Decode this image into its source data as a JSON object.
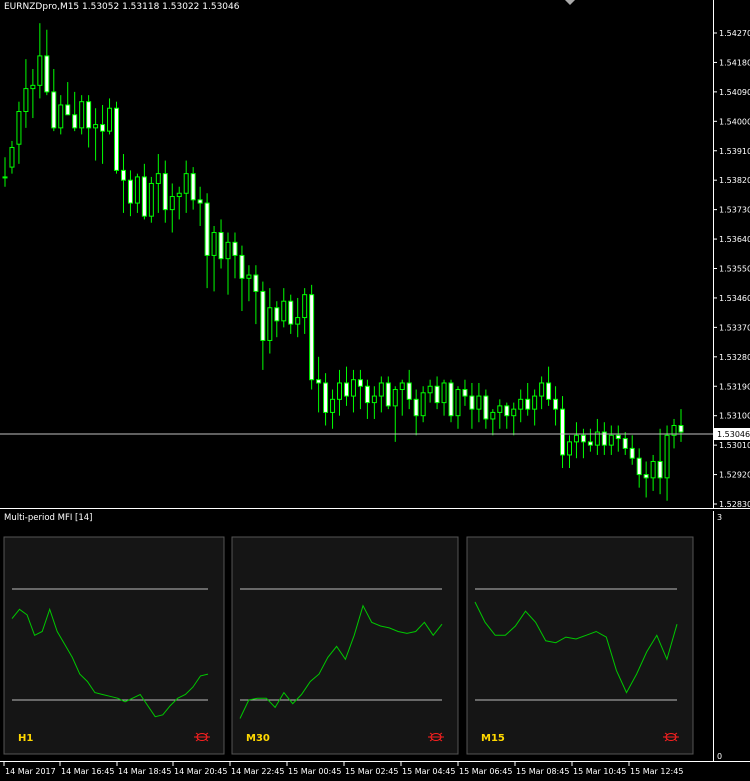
{
  "window": {
    "symbol_line": "EURNZDpro,M15  1.53052 1.53118 1.53022 1.53046",
    "current_price_label": "1.53046",
    "indicator_title": "Multi-period MFI [14]"
  },
  "colors": {
    "background": "#000000",
    "candle_up": "#000000",
    "candle_down": "#ffffff",
    "candle_outline": "#00ff00",
    "bid_line": "#c0c0c0",
    "mfi_line": "#00c800",
    "panel_bg": "#151515",
    "label": "#ffd800",
    "alert_icon": "#ff2020"
  },
  "price_axis": {
    "labels": [
      "1.54270",
      "1.54180",
      "1.54090",
      "1.54000",
      "1.53910",
      "1.53820",
      "1.53730",
      "1.53640",
      "1.53550",
      "1.53460",
      "1.53370",
      "1.53280",
      "1.53190",
      "1.53100",
      "1.53010",
      "1.52920",
      "1.52830"
    ],
    "values": [
      1.5427,
      1.5418,
      1.5409,
      1.54,
      1.5391,
      1.5382,
      1.5373,
      1.5364,
      1.5355,
      1.5346,
      1.5337,
      1.5328,
      1.5319,
      1.531,
      1.5301,
      1.5292,
      1.5283
    ]
  },
  "indicator_axis": {
    "max_label": "3",
    "min_label": "0"
  },
  "time_axis": {
    "labels": [
      "14 Mar 2017",
      "14 Mar 16:45",
      "14 Mar 18:45",
      "14 Mar 20:45",
      "14 Mar 22:45",
      "15 Mar 00:45",
      "15 Mar 02:45",
      "15 Mar 04:45",
      "15 Mar 06:45",
      "15 Mar 08:45",
      "15 Mar 10:45",
      "15 Mar 12:45"
    ]
  },
  "mfi_panels": [
    {
      "label": "H1",
      "icon": "alarm-icon",
      "overbought": 80,
      "oversold": 20,
      "values": [
        64,
        69,
        66,
        55,
        57,
        69,
        57,
        50,
        43,
        34,
        30,
        24,
        23,
        22,
        21,
        19,
        21,
        23,
        17,
        11,
        12,
        17,
        21,
        23,
        27,
        33,
        34
      ]
    },
    {
      "label": "M30",
      "icon": "alarm-icon",
      "overbought": 80,
      "oversold": 20,
      "values": [
        10,
        20,
        21,
        21,
        16,
        24,
        18,
        23,
        30,
        34,
        43,
        49,
        42,
        55,
        71,
        62,
        60,
        59,
        57,
        56,
        57,
        62,
        55,
        61
      ]
    },
    {
      "label": "M15",
      "icon": "alarm-icon",
      "overbought": 80,
      "oversold": 20,
      "values": [
        73,
        62,
        55,
        55,
        60,
        68,
        62,
        52,
        51,
        54,
        53,
        55,
        57,
        54,
        36,
        24,
        34,
        46,
        55,
        42,
        61
      ]
    }
  ],
  "chart_data": {
    "type": "candlestick",
    "symbol": "EURNZDpro,M15",
    "ylim": [
      1.5283,
      1.5432
    ],
    "candles": [
      [
        1.5383,
        1.5389,
        1.538,
        1.5383
      ],
      [
        1.5386,
        1.5394,
        1.5384,
        1.5392
      ],
      [
        1.5393,
        1.5406,
        1.5387,
        1.5403
      ],
      [
        1.5403,
        1.5419,
        1.5398,
        1.541
      ],
      [
        1.541,
        1.5416,
        1.5401,
        1.5411
      ],
      [
        1.5411,
        1.543,
        1.5407,
        1.542
      ],
      [
        1.542,
        1.5428,
        1.5408,
        1.5409
      ],
      [
        1.5409,
        1.5416,
        1.5397,
        1.5398
      ],
      [
        1.5398,
        1.5408,
        1.5396,
        1.5405
      ],
      [
        1.5405,
        1.5412,
        1.5402,
        1.5402
      ],
      [
        1.5402,
        1.5409,
        1.5397,
        1.5398
      ],
      [
        1.5398,
        1.5408,
        1.5396,
        1.5406
      ],
      [
        1.5406,
        1.5408,
        1.5392,
        1.5398
      ],
      [
        1.5398,
        1.5404,
        1.5388,
        1.5399
      ],
      [
        1.5399,
        1.5405,
        1.5387,
        1.5397
      ],
      [
        1.5397,
        1.5407,
        1.5396,
        1.5404
      ],
      [
        1.5404,
        1.5406,
        1.5384,
        1.5385
      ],
      [
        1.5385,
        1.539,
        1.5372,
        1.5382
      ],
      [
        1.5382,
        1.5385,
        1.5371,
        1.5375
      ],
      [
        1.5375,
        1.5384,
        1.5372,
        1.5383
      ],
      [
        1.5383,
        1.5387,
        1.537,
        1.5371
      ],
      [
        1.5371,
        1.5383,
        1.5369,
        1.5381
      ],
      [
        1.5381,
        1.539,
        1.5372,
        1.5384
      ],
      [
        1.5384,
        1.5388,
        1.5369,
        1.5373
      ],
      [
        1.5373,
        1.5381,
        1.5366,
        1.5377
      ],
      [
        1.5377,
        1.538,
        1.537,
        1.5378
      ],
      [
        1.5378,
        1.5388,
        1.5372,
        1.5384
      ],
      [
        1.5384,
        1.5386,
        1.5373,
        1.5376
      ],
      [
        1.5376,
        1.538,
        1.5368,
        1.5375
      ],
      [
        1.5375,
        1.5378,
        1.5349,
        1.5359
      ],
      [
        1.5359,
        1.5368,
        1.5348,
        1.5366
      ],
      [
        1.5366,
        1.537,
        1.5355,
        1.5358
      ],
      [
        1.5358,
        1.5366,
        1.5347,
        1.5363
      ],
      [
        1.5363,
        1.5366,
        1.5352,
        1.5359
      ],
      [
        1.5359,
        1.5362,
        1.5342,
        1.5352
      ],
      [
        1.5352,
        1.5356,
        1.5345,
        1.5353
      ],
      [
        1.5353,
        1.5356,
        1.5338,
        1.5348
      ],
      [
        1.5348,
        1.5351,
        1.5324,
        1.5333
      ],
      [
        1.5333,
        1.5349,
        1.5329,
        1.5343
      ],
      [
        1.5343,
        1.5345,
        1.5334,
        1.5339
      ],
      [
        1.5339,
        1.5349,
        1.5337,
        1.5345
      ],
      [
        1.5345,
        1.5347,
        1.5335,
        1.5338
      ],
      [
        1.5338,
        1.5346,
        1.5334,
        1.534
      ],
      [
        1.534,
        1.5349,
        1.5335,
        1.5347
      ],
      [
        1.5347,
        1.535,
        1.5318,
        1.5321
      ],
      [
        1.5321,
        1.5328,
        1.5311,
        1.532
      ],
      [
        1.532,
        1.5323,
        1.5307,
        1.5311
      ],
      [
        1.5311,
        1.5318,
        1.5306,
        1.5315
      ],
      [
        1.5315,
        1.5324,
        1.531,
        1.532
      ],
      [
        1.532,
        1.5325,
        1.5313,
        1.5316
      ],
      [
        1.5316,
        1.5324,
        1.5311,
        1.5321
      ],
      [
        1.5321,
        1.5324,
        1.5312,
        1.5319
      ],
      [
        1.5319,
        1.5321,
        1.5309,
        1.5314
      ],
      [
        1.5314,
        1.5319,
        1.5309,
        1.5316
      ],
      [
        1.5316,
        1.5322,
        1.5311,
        1.532
      ],
      [
        1.532,
        1.5322,
        1.5312,
        1.5313
      ],
      [
        1.5313,
        1.5319,
        1.5302,
        1.5318
      ],
      [
        1.5318,
        1.5321,
        1.531,
        1.532
      ],
      [
        1.532,
        1.5324,
        1.5312,
        1.5315
      ],
      [
        1.5315,
        1.5318,
        1.5304,
        1.531
      ],
      [
        1.531,
        1.5319,
        1.5308,
        1.5317
      ],
      [
        1.5317,
        1.5321,
        1.5314,
        1.5319
      ],
      [
        1.5319,
        1.5322,
        1.5312,
        1.5314
      ],
      [
        1.5314,
        1.5321,
        1.531,
        1.532
      ],
      [
        1.532,
        1.5321,
        1.5308,
        1.531
      ],
      [
        1.531,
        1.5319,
        1.5306,
        1.5318
      ],
      [
        1.5318,
        1.5321,
        1.5313,
        1.5316
      ],
      [
        1.5316,
        1.532,
        1.5306,
        1.5312
      ],
      [
        1.5312,
        1.532,
        1.5308,
        1.5316
      ],
      [
        1.5316,
        1.5318,
        1.5306,
        1.5309
      ],
      [
        1.5309,
        1.5312,
        1.5304,
        1.5311
      ],
      [
        1.5311,
        1.5315,
        1.5306,
        1.5313
      ],
      [
        1.5313,
        1.5314,
        1.5306,
        1.531
      ],
      [
        1.531,
        1.5314,
        1.5304,
        1.5312
      ],
      [
        1.5312,
        1.5318,
        1.5308,
        1.5315
      ],
      [
        1.5315,
        1.532,
        1.531,
        1.5312
      ],
      [
        1.5312,
        1.5318,
        1.5307,
        1.5316
      ],
      [
        1.5316,
        1.5322,
        1.5312,
        1.532
      ],
      [
        1.532,
        1.5325,
        1.5313,
        1.5315
      ],
      [
        1.5315,
        1.5319,
        1.5307,
        1.5312
      ],
      [
        1.5312,
        1.5316,
        1.5294,
        1.5298
      ],
      [
        1.5298,
        1.5304,
        1.5294,
        1.5302
      ],
      [
        1.5302,
        1.5308,
        1.5297,
        1.5304
      ],
      [
        1.5304,
        1.5306,
        1.5297,
        1.5302
      ],
      [
        1.5302,
        1.5306,
        1.5299,
        1.5301
      ],
      [
        1.5301,
        1.5309,
        1.5298,
        1.5305
      ],
      [
        1.5305,
        1.5308,
        1.5298,
        1.5301
      ],
      [
        1.5301,
        1.5307,
        1.5298,
        1.5304
      ],
      [
        1.5304,
        1.5307,
        1.5299,
        1.5303
      ],
      [
        1.5303,
        1.5305,
        1.5298,
        1.53
      ],
      [
        1.53,
        1.5304,
        1.5295,
        1.5297
      ],
      [
        1.5297,
        1.53,
        1.5288,
        1.5292
      ],
      [
        1.5292,
        1.5296,
        1.5285,
        1.5291
      ],
      [
        1.5291,
        1.5298,
        1.5287,
        1.5296
      ],
      [
        1.5296,
        1.5306,
        1.5286,
        1.5291
      ],
      [
        1.5291,
        1.5307,
        1.5284,
        1.5304
      ],
      [
        1.5304,
        1.5309,
        1.53,
        1.5307
      ],
      [
        1.5307,
        1.5312,
        1.5302,
        1.5305
      ]
    ]
  }
}
